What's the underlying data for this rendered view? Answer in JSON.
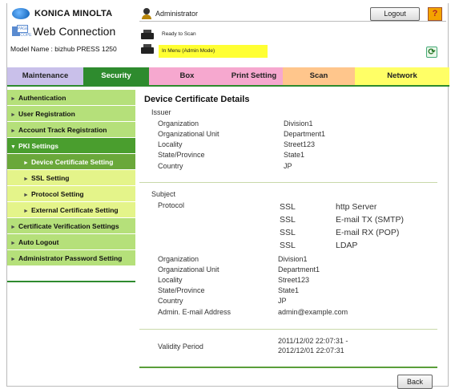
{
  "header": {
    "brand": "KONICA MINOLTA",
    "ps_logo_text": "PAGE SCOPE",
    "web_connection": "Web Connection",
    "model_name": "Model Name : bizhub PRESS 1250",
    "user": "Administrator",
    "logout_label": "Logout",
    "help_label": "?",
    "status_ready": "Ready to Scan",
    "status_menu": "In Menu (Admin Mode)",
    "refresh_icon": "refresh-icon"
  },
  "tabs": [
    {
      "label": "Maintenance"
    },
    {
      "label": "Security"
    },
    {
      "label": "Box"
    },
    {
      "label": "Print Setting"
    },
    {
      "label": "Scan"
    },
    {
      "label": "Network"
    }
  ],
  "sidebar": {
    "items": [
      {
        "label": "Authentication"
      },
      {
        "label": "User Registration"
      },
      {
        "label": "Account Track Registration"
      },
      {
        "label": "PKI Settings"
      },
      {
        "label": "Device Certificate Setting"
      },
      {
        "label": "SSL Setting"
      },
      {
        "label": "Protocol Setting"
      },
      {
        "label": "External Certificate Setting"
      },
      {
        "label": "Certificate Verification Settings"
      },
      {
        "label": "Auto Logout"
      },
      {
        "label": "Administrator Password Setting"
      }
    ]
  },
  "main": {
    "title": "Device Certificate Details",
    "issuer": {
      "label": "Issuer",
      "rows": [
        {
          "k": "Organization",
          "v": "Division1"
        },
        {
          "k": "Organizational Unit",
          "v": "Department1"
        },
        {
          "k": "Locality",
          "v": "Street123"
        },
        {
          "k": "State/Province",
          "v": "State1"
        },
        {
          "k": "Country",
          "v": "JP"
        }
      ]
    },
    "subject": {
      "label": "Subject",
      "protocol_label": "Protocol",
      "protocols": [
        {
          "ssl": "SSL",
          "val": "http Server"
        },
        {
          "ssl": "SSL",
          "val": "E-mail TX (SMTP)"
        },
        {
          "ssl": "SSL",
          "val": "E-mail RX (POP)"
        },
        {
          "ssl": "SSL",
          "val": "LDAP"
        }
      ],
      "rows": [
        {
          "k": "Organization",
          "v": "Division1"
        },
        {
          "k": "Organizational Unit",
          "v": "Department1"
        },
        {
          "k": "Locality",
          "v": "Street123"
        },
        {
          "k": "State/Province",
          "v": "State1"
        },
        {
          "k": "Country",
          "v": "JP"
        },
        {
          "k": "Admin. E-mail Address",
          "v": "admin@example.com"
        }
      ]
    },
    "validity": {
      "label": "Validity Period",
      "from": "2011/12/02 22:07:31 -",
      "to": "2012/12/01 22:07:31"
    },
    "back_label": "Back"
  }
}
